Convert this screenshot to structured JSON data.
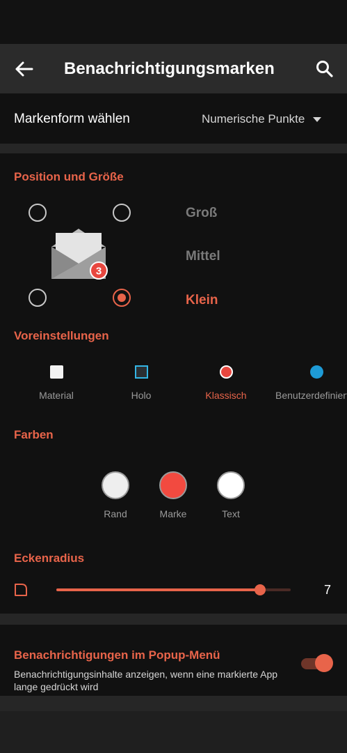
{
  "appbar": {
    "title": "Benachrichtigungsmarken",
    "back_icon": "arrow-left-icon",
    "search_icon": "search-icon"
  },
  "shape": {
    "label": "Markenform wählen",
    "selected": "Numerische Punkte"
  },
  "position_section": {
    "title": "Position und Größe",
    "sizes": [
      "Groß",
      "Mittel",
      "Klein"
    ],
    "selected_size": "Klein",
    "preview_badge_count": "3"
  },
  "presets_section": {
    "title": "Voreinstellungen",
    "items": [
      {
        "label": "Material",
        "color": "#f2f2f2"
      },
      {
        "label": "Holo",
        "color": "#33b5e5"
      },
      {
        "label": "Klassisch",
        "color": "#e8473f"
      },
      {
        "label": "Benutzerdefiniert",
        "color": "#1e9bd6"
      }
    ],
    "selected": "Klassisch"
  },
  "colors_section": {
    "title": "Farben",
    "items": [
      {
        "label": "Rand",
        "color": "#eeeeee"
      },
      {
        "label": "Marke",
        "color": "#f24a40"
      },
      {
        "label": "Text",
        "color": "#ffffff"
      }
    ]
  },
  "corner_section": {
    "title": "Eckenradius",
    "value": "7",
    "slider_fraction": 0.87
  },
  "popup_section": {
    "title": "Benachrichtigungen im Popup-Menü",
    "description": "Benachrichtigungsinhalte anzeigen, wenn eine markierte App lange gedrückt wird",
    "enabled": true
  },
  "accent_color": "#e8644a"
}
